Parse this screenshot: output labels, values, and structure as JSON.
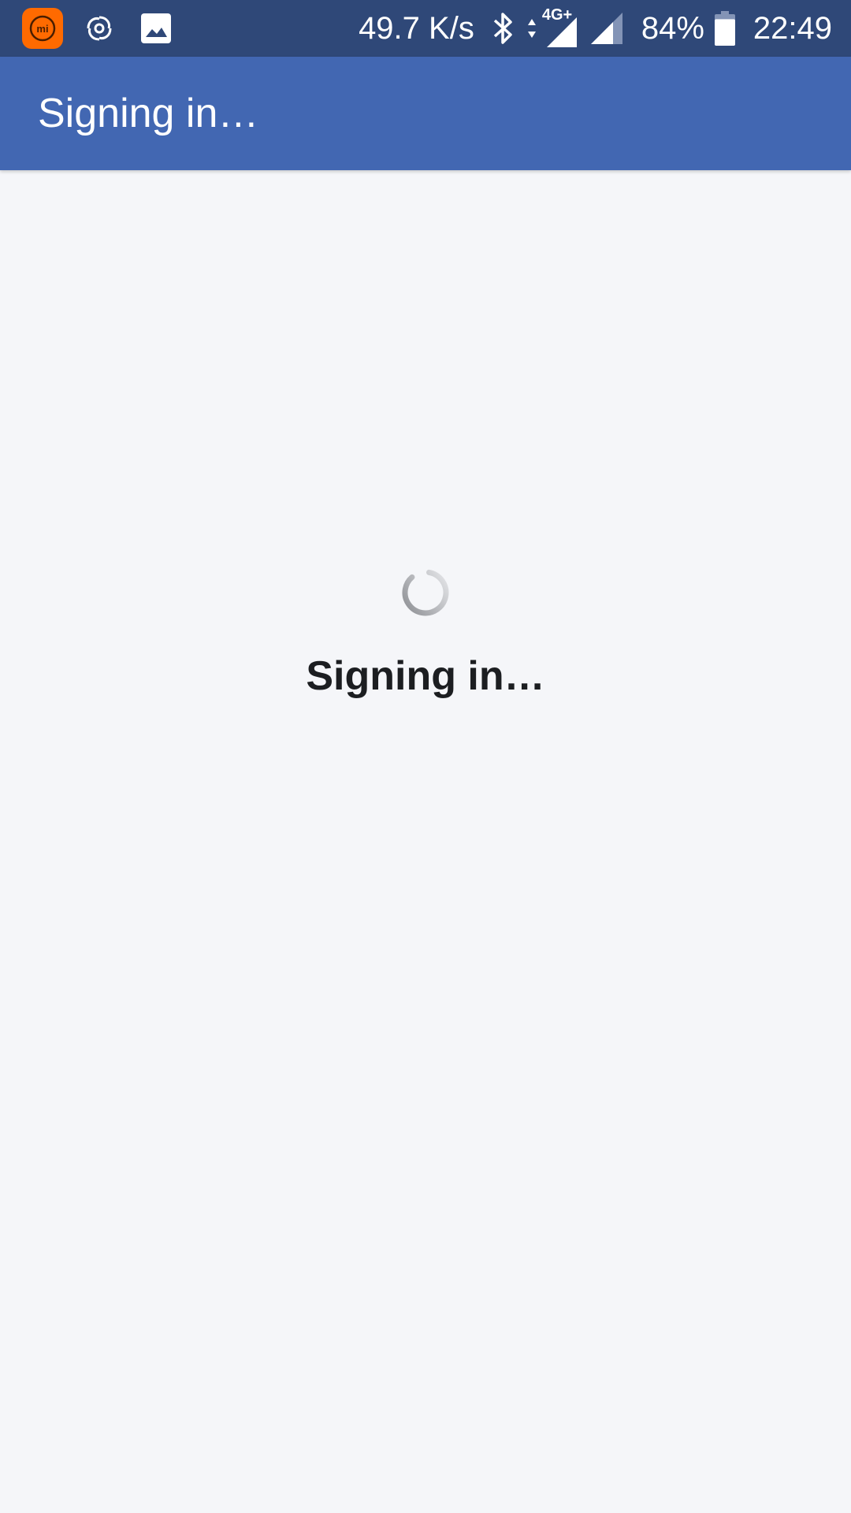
{
  "status_bar": {
    "net_speed": "49.7 K/s",
    "network_type": "4G+",
    "battery_percent": "84%",
    "battery_level": 0.84,
    "time": "22:49",
    "icons": {
      "app": "mi-app-icon",
      "notification_1": "swirl-icon",
      "notification_2": "image-icon",
      "bluetooth": "bluetooth-icon",
      "data_activity": "data-arrows-icon",
      "signal_1": "signal-full-icon",
      "signal_2": "signal-partial-icon",
      "battery": "battery-icon"
    }
  },
  "app_bar": {
    "title": "Signing in…",
    "color": "#4267b2"
  },
  "main": {
    "spinner_icon": "loading-spinner-icon",
    "message": "Signing in…"
  },
  "colors": {
    "status_bar_bg": "#2f4878",
    "app_bar_bg": "#4267b2",
    "page_bg": "#f5f6f9",
    "mi_orange": "#ff6a00"
  }
}
